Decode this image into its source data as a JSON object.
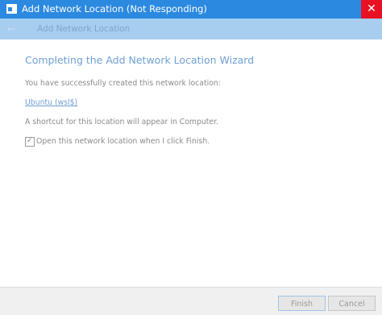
{
  "window": {
    "title": "Add Network Location (Not Responding)",
    "close_glyph": "✕",
    "accent_color": "#2b89e0",
    "close_color": "#e81123"
  },
  "header": {
    "back_glyph": "←",
    "title": "Add Network Location"
  },
  "content": {
    "heading": "Completing the Add Network Location Wizard",
    "success_text": "You have successfully created this network location:",
    "location_link": "Ubuntu (wsl$)",
    "shortcut_text": "A shortcut for this location will appear in Computer.",
    "open_checkbox": {
      "label": "Open this network location when I click Finish.",
      "checked": true,
      "check_glyph": "✓"
    }
  },
  "footer": {
    "finish_label": "Finish",
    "cancel_label": "Cancel"
  },
  "icons": {
    "app": "network-location-icon",
    "back": "back-arrow-icon",
    "close": "close-icon"
  }
}
